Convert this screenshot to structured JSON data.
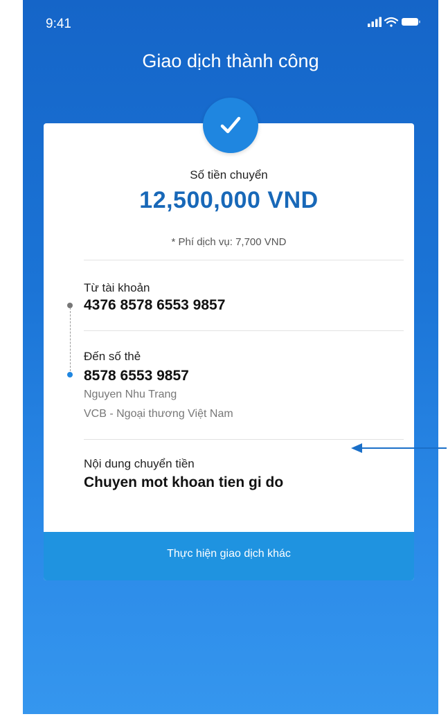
{
  "status_bar": {
    "time": "9:41"
  },
  "header": {
    "title": "Giao dịch thành công"
  },
  "amount": {
    "label": "Số tiền chuyển",
    "value": "12,500,000 VND",
    "fee": "* Phí dịch vụ: 7,700 VND"
  },
  "from_account": {
    "label": "Từ tài khoản",
    "number": "4376 8578 6553 9857"
  },
  "to_card": {
    "label": "Đến số thẻ",
    "number": "8578 6553 9857",
    "name": "Nguyen Nhu Trang",
    "bank": "VCB - Ngoại thương Việt Nam"
  },
  "content": {
    "label": "Nội dung chuyển tiền",
    "value": "Chuyen mot khoan tien gi do"
  },
  "action": {
    "label": "Thực hiện giao dịch khác"
  },
  "colors": {
    "background_top": "#1565c8",
    "background_bottom": "#3596ee",
    "amount": "#1868b8",
    "button": "#1f93e0",
    "check_badge": "#1f86e0",
    "annotation_arrow": "#1a6fc8"
  },
  "icons": [
    "check-icon",
    "signal-icon",
    "wifi-icon",
    "battery-icon",
    "arrow-left-icon"
  ]
}
